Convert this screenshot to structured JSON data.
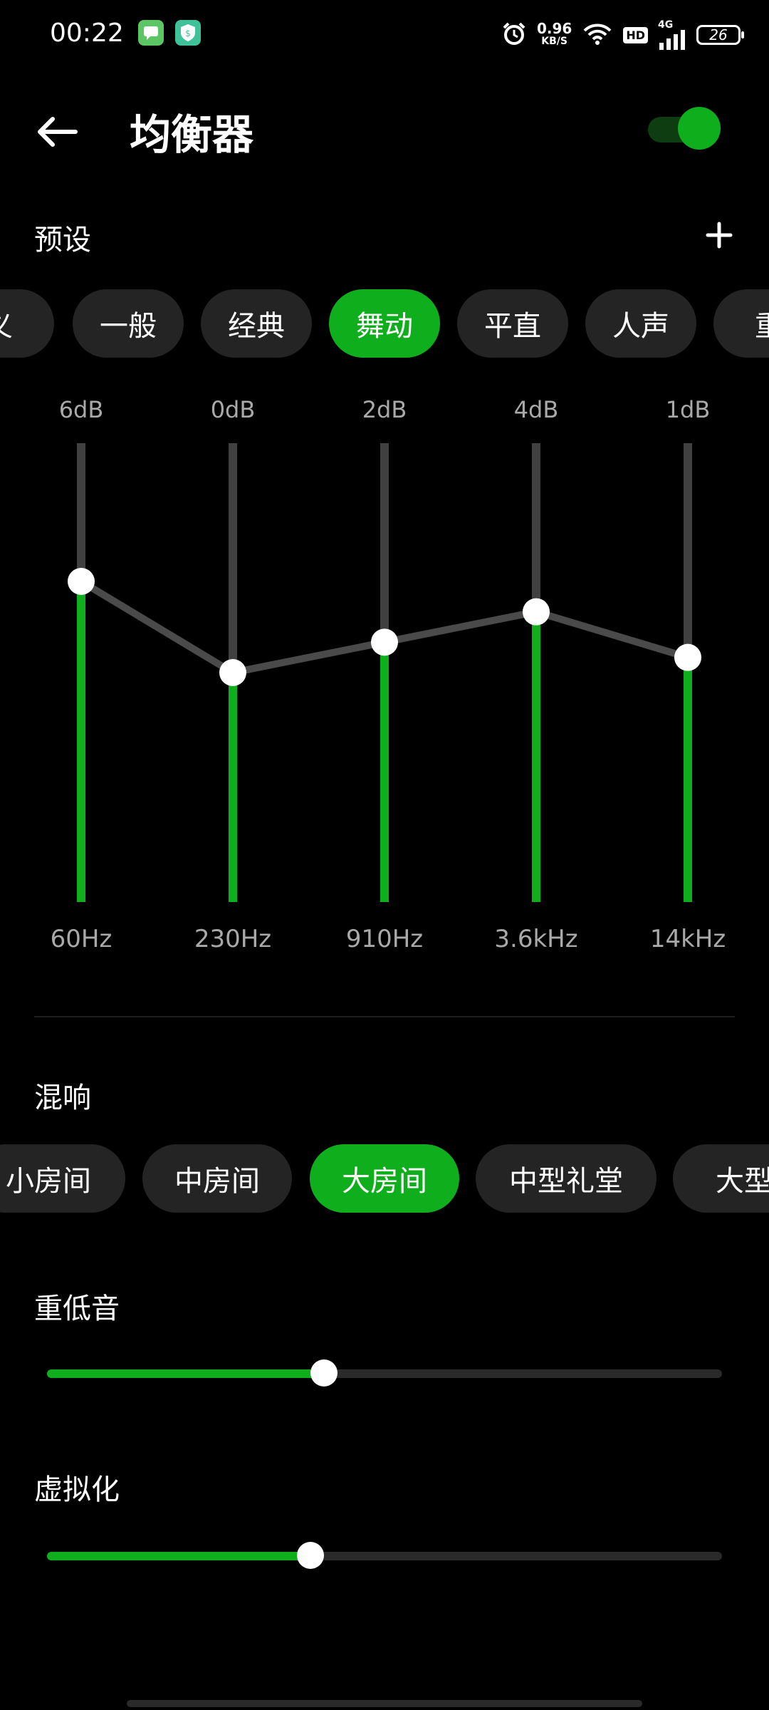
{
  "status_bar": {
    "time": "00:22",
    "net_speed_value": "0.96",
    "net_speed_unit": "KB/S",
    "hd": "HD",
    "network": "4G",
    "battery": "26"
  },
  "header": {
    "title": "均衡器",
    "toggle_on": true
  },
  "presets": {
    "title": "预设",
    "add_symbol": "+",
    "chips": [
      "义",
      "一般",
      "经典",
      "舞动",
      "平直",
      "人声",
      "重"
    ],
    "active_index": 3
  },
  "equalizer": {
    "range_db": [
      -6,
      6
    ],
    "bands": [
      {
        "freq": "60Hz",
        "db_label": "6dB",
        "value": 6
      },
      {
        "freq": "230Hz",
        "db_label": "0dB",
        "value": 0
      },
      {
        "freq": "910Hz",
        "db_label": "2dB",
        "value": 2
      },
      {
        "freq": "3.6kHz",
        "db_label": "4dB",
        "value": 4
      },
      {
        "freq": "14kHz",
        "db_label": "1dB",
        "value": 1
      }
    ],
    "colors": {
      "active": "#0fae1d",
      "inactive": "#404040",
      "curve": "#4a4a4a"
    }
  },
  "reverb": {
    "title": "混响",
    "chips": [
      "小房间",
      "中房间",
      "大房间",
      "中型礼堂",
      "大型礼"
    ],
    "active_index": 2
  },
  "bass": {
    "title": "重低音",
    "level": 0.41
  },
  "virtualizer": {
    "title": "虚拟化",
    "level": 0.39
  }
}
